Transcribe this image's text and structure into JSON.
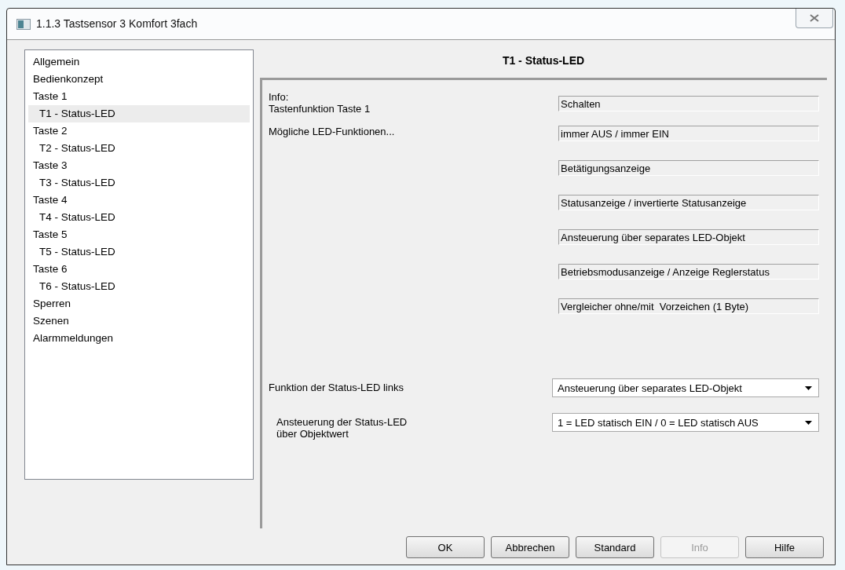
{
  "window": {
    "title": "1.1.3 Tastsensor 3 Komfort 3fach"
  },
  "tree": [
    {
      "label": "Allgemein",
      "selected": false
    },
    {
      "label": "Bedienkonzept",
      "selected": false
    },
    {
      "label": "Taste 1",
      "selected": false,
      "children": [
        {
          "label": "T1 - Status-LED",
          "selected": true
        }
      ]
    },
    {
      "label": "Taste 2",
      "selected": false,
      "children": [
        {
          "label": "T2 - Status-LED",
          "selected": false
        }
      ]
    },
    {
      "label": "Taste 3",
      "selected": false,
      "children": [
        {
          "label": "T3 - Status-LED",
          "selected": false
        }
      ]
    },
    {
      "label": "Taste 4",
      "selected": false,
      "children": [
        {
          "label": "T4 - Status-LED",
          "selected": false
        }
      ]
    },
    {
      "label": "Taste 5",
      "selected": false,
      "children": [
        {
          "label": "T5 - Status-LED",
          "selected": false
        }
      ]
    },
    {
      "label": "Taste 6",
      "selected": false,
      "children": [
        {
          "label": "T6 - Status-LED",
          "selected": false
        }
      ]
    },
    {
      "label": "Sperren",
      "selected": false
    },
    {
      "label": "Szenen",
      "selected": false
    },
    {
      "label": "Alarmmeldungen",
      "selected": false
    }
  ],
  "page": {
    "title": "T1 - Status-LED",
    "info_heading": "Info:",
    "key_function": {
      "label": "Tastenfunktion Taste 1",
      "value": "Schalten"
    },
    "led_functions": {
      "label": "Mögliche LED-Funktionen...",
      "values": [
        "immer AUS / immer EIN",
        "Betätigungsanzeige",
        "Statusanzeige / invertierte Statusanzeige",
        "Ansteuerung über separates LED-Objekt",
        "Betriebsmodusanzeige / Anzeige Reglerstatus",
        "Vergleicher ohne/mit  Vorzeichen (1 Byte)"
      ]
    },
    "settings": [
      {
        "kind": "main",
        "label": "Funktion der Status-LED links",
        "value": "Ansteuerung über separates LED-Objekt"
      },
      {
        "kind": "sub",
        "label": "Ansteuerung der Status-LED\nüber Objektwert",
        "value": "1 = LED statisch EIN / 0 = LED statisch AUS"
      }
    ]
  },
  "buttons": [
    {
      "label": "OK",
      "disabled": false
    },
    {
      "label": "Abbrechen",
      "disabled": false
    },
    {
      "label": "Standard",
      "disabled": false
    },
    {
      "label": "Info",
      "disabled": true
    },
    {
      "label": "Hilfe",
      "disabled": false
    }
  ]
}
